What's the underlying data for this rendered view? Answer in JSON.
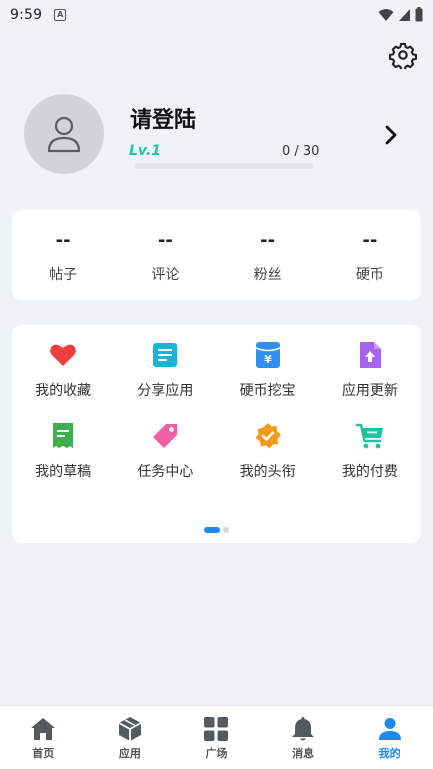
{
  "status_bar": {
    "time": "9:59",
    "notification_badge": "A"
  },
  "profile": {
    "username": "请登陆",
    "level": "Lv.1",
    "progress_text": "0 / 30",
    "progress_fraction": 0
  },
  "stats": [
    {
      "value": "--",
      "label": "帖子"
    },
    {
      "value": "--",
      "label": "评论"
    },
    {
      "value": "--",
      "label": "粉丝"
    },
    {
      "value": "--",
      "label": "硬币"
    }
  ],
  "grid": [
    {
      "label": "我的收藏",
      "icon": "heart-icon",
      "color": "#ee3f3f"
    },
    {
      "label": "分享应用",
      "icon": "document-icon",
      "color": "#14b6d8"
    },
    {
      "label": "硬币挖宝",
      "icon": "coin-wallet-icon",
      "color": "#2f8ef0"
    },
    {
      "label": "应用更新",
      "icon": "upload-file-icon",
      "color": "#a764e8"
    },
    {
      "label": "我的草稿",
      "icon": "receipt-icon",
      "color": "#3fae4e"
    },
    {
      "label": "任务中心",
      "icon": "tag-icon",
      "color": "#ef5fa3"
    },
    {
      "label": "我的头衔",
      "icon": "verified-badge-icon",
      "color": "#f39a1a"
    },
    {
      "label": "我的付费",
      "icon": "shopping-cart-icon",
      "color": "#1ec3a2"
    }
  ],
  "pager": {
    "pages": 2,
    "current": 1
  },
  "tabs": [
    {
      "label": "首页",
      "icon": "home-icon",
      "active": false
    },
    {
      "label": "应用",
      "icon": "cube-icon",
      "active": false
    },
    {
      "label": "广场",
      "icon": "grid-icon",
      "active": false
    },
    {
      "label": "消息",
      "icon": "bell-icon",
      "active": false
    },
    {
      "label": "我的",
      "icon": "person-icon",
      "active": true
    }
  ],
  "colors": {
    "accent": "#1a8be8",
    "level": "#1cc6a6",
    "background": "#eff2f7"
  }
}
